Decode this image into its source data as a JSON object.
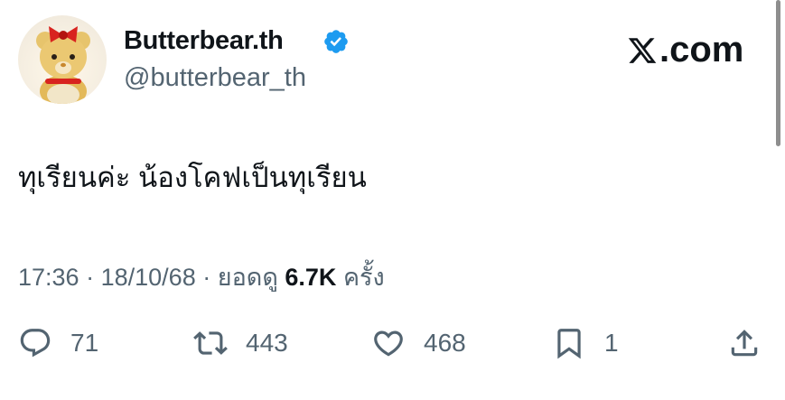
{
  "author": {
    "display_name": "Butterbear.th",
    "handle": "@butterbear_th",
    "verified": true,
    "avatar": "avatar-bear-icon"
  },
  "brand": {
    "suffix": ".com",
    "logo_icon": "x-logo-icon"
  },
  "tweet": {
    "text": "ทุเรียนค่ะ น้องโคฟเป็นทุเรียน",
    "time": "17:36",
    "date": "18/10/68",
    "views_label": "ยอดดู",
    "views_count": "6.7K",
    "views_unit": "ครั้ง",
    "separator": "·"
  },
  "actions": {
    "reply": {
      "icon": "reply-icon",
      "count": "71"
    },
    "retweet": {
      "icon": "retweet-icon",
      "count": "443"
    },
    "like": {
      "icon": "heart-icon",
      "count": "468"
    },
    "bookmark": {
      "icon": "bookmark-icon",
      "count": "1"
    },
    "share": {
      "icon": "share-icon"
    }
  },
  "colors": {
    "text": "#0f1419",
    "secondary": "#536471",
    "verified": "#1d9bf0"
  }
}
